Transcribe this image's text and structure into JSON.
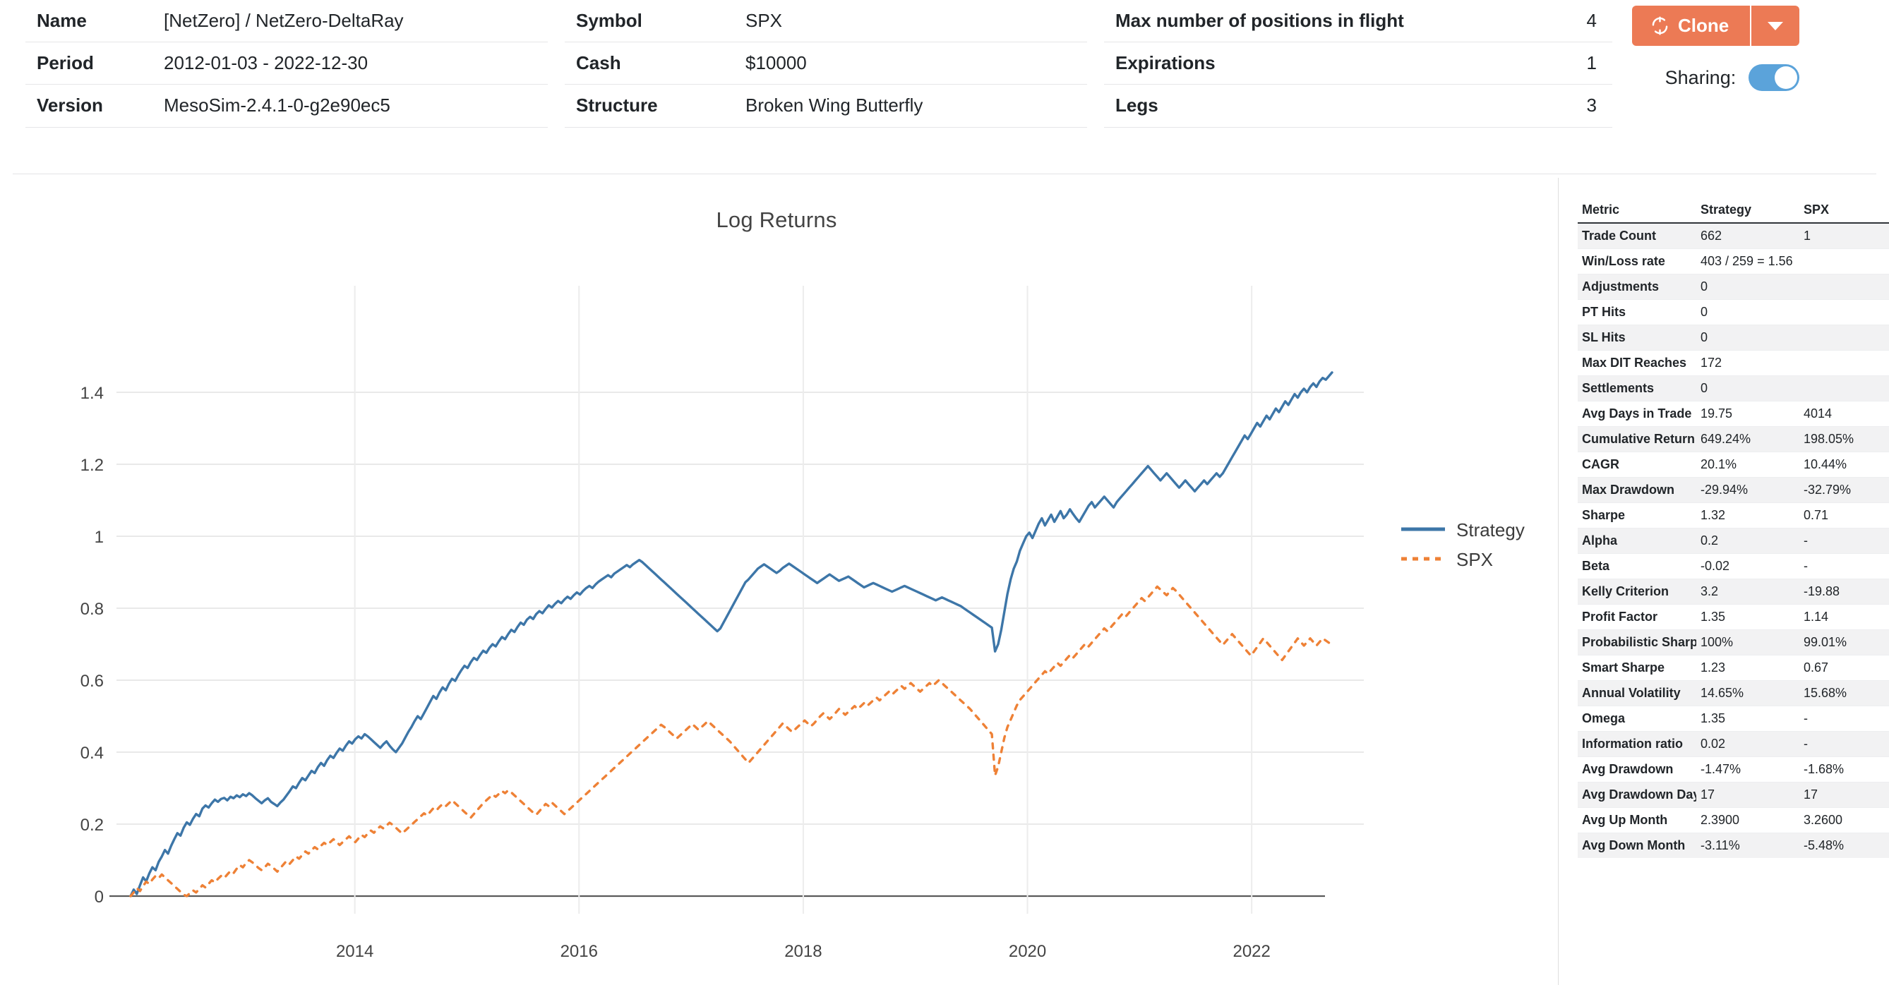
{
  "header": {
    "col1": [
      {
        "key": "Name",
        "value": "[NetZero] / NetZero-DeltaRay"
      },
      {
        "key": "Period",
        "value": "2012-01-03 - 2022-12-30"
      },
      {
        "key": "Version",
        "value": "MesoSim-2.4.1-0-g2e90ec5"
      }
    ],
    "col2": [
      {
        "key": "Symbol",
        "value": "SPX"
      },
      {
        "key": "Cash",
        "value": "$10000"
      },
      {
        "key": "Structure",
        "value": "Broken Wing Butterfly"
      }
    ],
    "col3": [
      {
        "key": "Max number of positions in flight",
        "value": "4"
      },
      {
        "key": "Expirations",
        "value": "1"
      },
      {
        "key": "Legs",
        "value": "3"
      }
    ],
    "clone_label": "Clone",
    "clone_icon": "refresh-icon",
    "caret_icon": "chevron-down-icon",
    "sharing_label": "Sharing:",
    "sharing_on": true,
    "accent_color": "#ec7a55",
    "toggle_color": "#5ba3da"
  },
  "chart_data": {
    "type": "line",
    "title": "Log Returns",
    "xlabel": "",
    "ylabel": "",
    "grid": true,
    "legend_position": "right",
    "xlim": [
      2012.0,
      2023.0
    ],
    "ylim": [
      0,
      1.5
    ],
    "xticks": [
      "2014",
      "2016",
      "2018",
      "2020",
      "2022"
    ],
    "xtick_values": [
      2014,
      2016,
      2018,
      2020,
      2022
    ],
    "yticks": [
      "0",
      "0.2",
      "0.4",
      "0.6",
      "0.8",
      "1",
      "1.2",
      "1.4"
    ],
    "ytick_values": [
      0,
      0.2,
      0.4,
      0.6,
      0.8,
      1.0,
      1.2,
      1.4
    ],
    "series": [
      {
        "name": "Strategy",
        "color": "#3d76a8",
        "style": "solid",
        "values": [
          0.0,
          0.018,
          0.006,
          0.03,
          0.052,
          0.041,
          0.063,
          0.08,
          0.072,
          0.095,
          0.11,
          0.128,
          0.118,
          0.14,
          0.158,
          0.175,
          0.168,
          0.19,
          0.205,
          0.198,
          0.215,
          0.228,
          0.222,
          0.243,
          0.252,
          0.246,
          0.258,
          0.268,
          0.262,
          0.27,
          0.273,
          0.266,
          0.276,
          0.272,
          0.28,
          0.275,
          0.283,
          0.278,
          0.286,
          0.28,
          0.272,
          0.265,
          0.258,
          0.266,
          0.272,
          0.262,
          0.256,
          0.25,
          0.26,
          0.268,
          0.28,
          0.292,
          0.305,
          0.3,
          0.315,
          0.328,
          0.322,
          0.335,
          0.348,
          0.342,
          0.358,
          0.37,
          0.362,
          0.378,
          0.39,
          0.384,
          0.398,
          0.41,
          0.404,
          0.418,
          0.43,
          0.424,
          0.436,
          0.444,
          0.438,
          0.45,
          0.444,
          0.436,
          0.428,
          0.42,
          0.412,
          0.422,
          0.43,
          0.418,
          0.408,
          0.4,
          0.412,
          0.424,
          0.44,
          0.456,
          0.47,
          0.486,
          0.5,
          0.492,
          0.508,
          0.524,
          0.54,
          0.556,
          0.548,
          0.566,
          0.58,
          0.572,
          0.59,
          0.604,
          0.598,
          0.614,
          0.628,
          0.64,
          0.634,
          0.65,
          0.662,
          0.656,
          0.67,
          0.682,
          0.676,
          0.69,
          0.7,
          0.694,
          0.708,
          0.72,
          0.714,
          0.728,
          0.74,
          0.734,
          0.748,
          0.76,
          0.754,
          0.768,
          0.776,
          0.77,
          0.784,
          0.792,
          0.786,
          0.798,
          0.808,
          0.802,
          0.812,
          0.82,
          0.814,
          0.824,
          0.832,
          0.826,
          0.836,
          0.844,
          0.838,
          0.848,
          0.856,
          0.862,
          0.856,
          0.866,
          0.874,
          0.88,
          0.886,
          0.892,
          0.886,
          0.896,
          0.902,
          0.908,
          0.914,
          0.92,
          0.914,
          0.922,
          0.928,
          0.934,
          0.928,
          0.92,
          0.912,
          0.904,
          0.896,
          0.888,
          0.88,
          0.872,
          0.864,
          0.856,
          0.848,
          0.84,
          0.832,
          0.824,
          0.816,
          0.808,
          0.8,
          0.792,
          0.784,
          0.776,
          0.768,
          0.76,
          0.752,
          0.744,
          0.736,
          0.744,
          0.76,
          0.776,
          0.792,
          0.808,
          0.824,
          0.84,
          0.856,
          0.872,
          0.88,
          0.89,
          0.9,
          0.91,
          0.916,
          0.922,
          0.916,
          0.91,
          0.904,
          0.898,
          0.904,
          0.912,
          0.918,
          0.924,
          0.918,
          0.912,
          0.906,
          0.9,
          0.894,
          0.888,
          0.882,
          0.876,
          0.87,
          0.876,
          0.882,
          0.888,
          0.894,
          0.888,
          0.882,
          0.876,
          0.88,
          0.884,
          0.888,
          0.882,
          0.876,
          0.87,
          0.864,
          0.858,
          0.862,
          0.866,
          0.87,
          0.866,
          0.862,
          0.858,
          0.854,
          0.85,
          0.846,
          0.85,
          0.854,
          0.858,
          0.862,
          0.858,
          0.854,
          0.85,
          0.846,
          0.842,
          0.838,
          0.834,
          0.83,
          0.826,
          0.822,
          0.826,
          0.83,
          0.826,
          0.822,
          0.818,
          0.814,
          0.81,
          0.806,
          0.8,
          0.794,
          0.788,
          0.782,
          0.776,
          0.77,
          0.764,
          0.758,
          0.752,
          0.746,
          0.68,
          0.7,
          0.74,
          0.79,
          0.84,
          0.88,
          0.91,
          0.93,
          0.96,
          0.98,
          1.0,
          1.01,
          0.995,
          1.015,
          1.035,
          1.05,
          1.03,
          1.045,
          1.06,
          1.04,
          1.055,
          1.07,
          1.05,
          1.06,
          1.075,
          1.062,
          1.05,
          1.04,
          1.055,
          1.07,
          1.085,
          1.095,
          1.08,
          1.09,
          1.1,
          1.11,
          1.1,
          1.09,
          1.08,
          1.095,
          1.105,
          1.115,
          1.125,
          1.135,
          1.145,
          1.155,
          1.165,
          1.175,
          1.185,
          1.195,
          1.185,
          1.175,
          1.165,
          1.155,
          1.165,
          1.175,
          1.165,
          1.155,
          1.145,
          1.135,
          1.145,
          1.155,
          1.145,
          1.135,
          1.125,
          1.135,
          1.145,
          1.155,
          1.145,
          1.155,
          1.165,
          1.175,
          1.165,
          1.175,
          1.19,
          1.205,
          1.22,
          1.235,
          1.25,
          1.265,
          1.28,
          1.27,
          1.285,
          1.3,
          1.315,
          1.305,
          1.32,
          1.335,
          1.325,
          1.34,
          1.355,
          1.345,
          1.36,
          1.375,
          1.365,
          1.38,
          1.395,
          1.385,
          1.4,
          1.41,
          1.4,
          1.415,
          1.425,
          1.415,
          1.43,
          1.44,
          1.435,
          1.445,
          1.455
        ]
      },
      {
        "name": "SPX",
        "color": "#ee8136",
        "style": "dotted",
        "values": [
          0.0,
          0.01,
          0.022,
          0.014,
          0.028,
          0.04,
          0.034,
          0.046,
          0.056,
          0.05,
          0.06,
          0.052,
          0.044,
          0.036,
          0.028,
          0.02,
          0.012,
          0.004,
          0.0,
          0.008,
          0.016,
          0.01,
          0.02,
          0.03,
          0.024,
          0.034,
          0.044,
          0.038,
          0.048,
          0.056,
          0.05,
          0.06,
          0.07,
          0.064,
          0.076,
          0.086,
          0.08,
          0.092,
          0.1,
          0.094,
          0.086,
          0.078,
          0.072,
          0.08,
          0.09,
          0.084,
          0.076,
          0.068,
          0.078,
          0.088,
          0.098,
          0.09,
          0.1,
          0.11,
          0.104,
          0.114,
          0.124,
          0.118,
          0.128,
          0.136,
          0.13,
          0.14,
          0.148,
          0.142,
          0.15,
          0.158,
          0.15,
          0.142,
          0.15,
          0.158,
          0.166,
          0.158,
          0.15,
          0.16,
          0.17,
          0.164,
          0.174,
          0.182,
          0.176,
          0.186,
          0.194,
          0.188,
          0.196,
          0.204,
          0.198,
          0.19,
          0.182,
          0.174,
          0.182,
          0.19,
          0.198,
          0.206,
          0.214,
          0.222,
          0.23,
          0.224,
          0.234,
          0.244,
          0.238,
          0.248,
          0.256,
          0.25,
          0.258,
          0.266,
          0.258,
          0.25,
          0.242,
          0.234,
          0.226,
          0.218,
          0.228,
          0.238,
          0.248,
          0.258,
          0.266,
          0.274,
          0.282,
          0.276,
          0.284,
          0.292,
          0.286,
          0.294,
          0.288,
          0.28,
          0.272,
          0.264,
          0.256,
          0.248,
          0.24,
          0.232,
          0.226,
          0.236,
          0.246,
          0.256,
          0.25,
          0.26,
          0.252,
          0.244,
          0.236,
          0.228,
          0.236,
          0.244,
          0.252,
          0.26,
          0.268,
          0.276,
          0.284,
          0.292,
          0.3,
          0.308,
          0.316,
          0.324,
          0.332,
          0.34,
          0.348,
          0.356,
          0.364,
          0.372,
          0.38,
          0.388,
          0.396,
          0.404,
          0.412,
          0.42,
          0.428,
          0.436,
          0.444,
          0.452,
          0.46,
          0.468,
          0.476,
          0.47,
          0.462,
          0.454,
          0.446,
          0.438,
          0.446,
          0.454,
          0.462,
          0.47,
          0.478,
          0.47,
          0.462,
          0.47,
          0.478,
          0.486,
          0.478,
          0.47,
          0.462,
          0.454,
          0.446,
          0.438,
          0.43,
          0.42,
          0.41,
          0.4,
          0.39,
          0.38,
          0.37,
          0.38,
          0.39,
          0.4,
          0.41,
          0.42,
          0.43,
          0.44,
          0.45,
          0.46,
          0.47,
          0.48,
          0.472,
          0.464,
          0.456,
          0.464,
          0.472,
          0.48,
          0.488,
          0.48,
          0.472,
          0.48,
          0.49,
          0.5,
          0.508,
          0.5,
          0.492,
          0.5,
          0.51,
          0.52,
          0.512,
          0.504,
          0.512,
          0.52,
          0.528,
          0.52,
          0.528,
          0.536,
          0.528,
          0.536,
          0.544,
          0.552,
          0.544,
          0.552,
          0.56,
          0.568,
          0.56,
          0.568,
          0.576,
          0.584,
          0.576,
          0.584,
          0.592,
          0.584,
          0.576,
          0.568,
          0.576,
          0.584,
          0.592,
          0.584,
          0.592,
          0.6,
          0.592,
          0.584,
          0.576,
          0.568,
          0.56,
          0.552,
          0.544,
          0.536,
          0.528,
          0.52,
          0.51,
          0.5,
          0.49,
          0.48,
          0.47,
          0.46,
          0.45,
          0.335,
          0.36,
          0.4,
          0.44,
          0.47,
          0.49,
          0.51,
          0.53,
          0.545,
          0.555,
          0.565,
          0.575,
          0.585,
          0.595,
          0.605,
          0.615,
          0.625,
          0.618,
          0.628,
          0.638,
          0.648,
          0.64,
          0.65,
          0.66,
          0.67,
          0.662,
          0.672,
          0.682,
          0.692,
          0.702,
          0.694,
          0.704,
          0.714,
          0.724,
          0.734,
          0.744,
          0.736,
          0.746,
          0.756,
          0.766,
          0.776,
          0.786,
          0.778,
          0.788,
          0.798,
          0.808,
          0.818,
          0.828,
          0.82,
          0.83,
          0.84,
          0.85,
          0.86,
          0.852,
          0.844,
          0.836,
          0.846,
          0.856,
          0.848,
          0.838,
          0.828,
          0.818,
          0.808,
          0.798,
          0.788,
          0.778,
          0.768,
          0.758,
          0.748,
          0.738,
          0.728,
          0.718,
          0.708,
          0.698,
          0.708,
          0.718,
          0.728,
          0.718,
          0.708,
          0.698,
          0.688,
          0.678,
          0.668,
          0.68,
          0.692,
          0.704,
          0.716,
          0.706,
          0.696,
          0.686,
          0.676,
          0.666,
          0.656,
          0.668,
          0.68,
          0.692,
          0.704,
          0.716,
          0.706,
          0.696,
          0.706,
          0.716,
          0.706,
          0.696,
          0.706,
          0.716,
          0.71,
          0.704,
          0.712
        ]
      }
    ]
  },
  "metrics": {
    "columns": [
      "Metric",
      "Strategy",
      "SPX"
    ],
    "rows": [
      {
        "metric": "Trade Count",
        "strategy": "662",
        "spx": "1"
      },
      {
        "metric": "Win/Loss rate",
        "strategy": "403 / 259 = 1.56",
        "spx": ""
      },
      {
        "metric": "Adjustments",
        "strategy": "0",
        "spx": ""
      },
      {
        "metric": "PT Hits",
        "strategy": "0",
        "spx": ""
      },
      {
        "metric": "SL Hits",
        "strategy": "0",
        "spx": ""
      },
      {
        "metric": "Max DIT Reaches",
        "strategy": "172",
        "spx": ""
      },
      {
        "metric": "Settlements",
        "strategy": "0",
        "spx": ""
      },
      {
        "metric": "Avg Days in Trade",
        "strategy": "19.75",
        "spx": "4014"
      },
      {
        "metric": "Cumulative Return",
        "strategy": "649.24%",
        "spx": "198.05%"
      },
      {
        "metric": "CAGR",
        "strategy": "20.1%",
        "spx": "10.44%"
      },
      {
        "metric": "Max Drawdown",
        "strategy": "-29.94%",
        "spx": "-32.79%"
      },
      {
        "metric": "Sharpe",
        "strategy": "1.32",
        "spx": "0.71"
      },
      {
        "metric": "Alpha",
        "strategy": "0.2",
        "spx": "-"
      },
      {
        "metric": "Beta",
        "strategy": "-0.02",
        "spx": "-"
      },
      {
        "metric": "Kelly Criterion",
        "strategy": "3.2",
        "spx": "-19.88"
      },
      {
        "metric": "Profit Factor",
        "strategy": "1.35",
        "spx": "1.14"
      },
      {
        "metric": "Probabilistic Sharpe",
        "strategy": "100%",
        "spx": "99.01%"
      },
      {
        "metric": "Smart Sharpe",
        "strategy": "1.23",
        "spx": "0.67"
      },
      {
        "metric": "Annual Volatility",
        "strategy": "14.65%",
        "spx": "15.68%"
      },
      {
        "metric": "Omega",
        "strategy": "1.35",
        "spx": "-"
      },
      {
        "metric": "Information ratio",
        "strategy": "0.02",
        "spx": "-"
      },
      {
        "metric": "Avg Drawdown",
        "strategy": "-1.47%",
        "spx": "-1.68%"
      },
      {
        "metric": "Avg Drawdown Days",
        "strategy": "17",
        "spx": "17"
      },
      {
        "metric": "Avg Up Month",
        "strategy": "2.3900",
        "spx": "3.2600"
      },
      {
        "metric": "Avg Down Month",
        "strategy": "-3.11%",
        "spx": "-5.48%"
      }
    ]
  }
}
